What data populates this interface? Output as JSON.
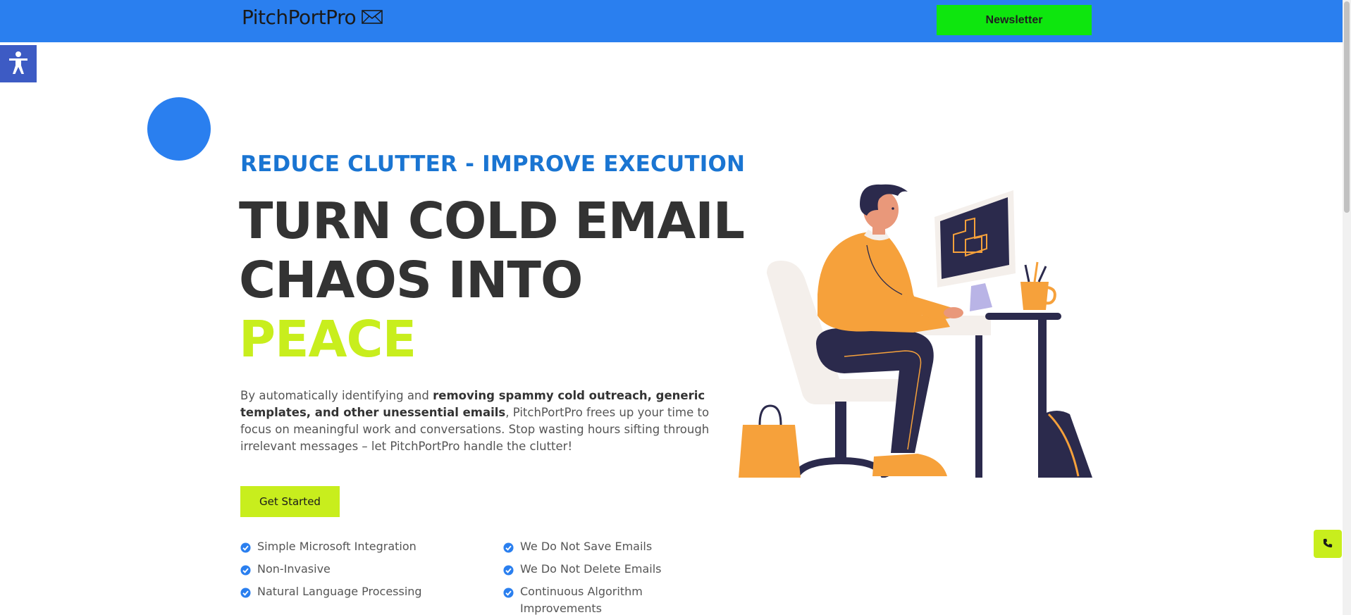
{
  "header": {
    "brand_name": "PitchPortPro",
    "brand_icon": "envelope-icon",
    "newsletter_label": "Newsletter",
    "colors": {
      "bar": "#2a7fef",
      "newsletter": "#0ee60e"
    }
  },
  "accessibility": {
    "icon": "accessibility-person-icon"
  },
  "hero": {
    "eyebrow": "REDUCE CLUTTER - IMPROVE EXECUTION",
    "headline_line1": "TURN COLD EMAIL",
    "headline_line2": "CHAOS INTO",
    "headline_accent": "PEACE",
    "intro_part1": "By automatically identifying and ",
    "intro_bold": "removing spammy cold outreach, generic templates, and other unessential emails",
    "intro_part2": ", PitchPortPro frees up your time to focus on meaningful work and conversations. Stop wasting hours sifting through irrelevant messages – let PitchPortPro handle the clutter!",
    "cta_label": "Get Started",
    "colors": {
      "eyebrow": "#1a75d2",
      "accent": "#c8ee1d",
      "headline": "#333333"
    }
  },
  "features": {
    "col1": [
      "Simple Microsoft Integration",
      "Non-Invasive",
      "Natural Language Processing"
    ],
    "col2": [
      "We Do Not Save Emails",
      "We Do Not Delete Emails",
      "Continuous Algorithm Improvements"
    ],
    "icon": "check-circle-icon"
  },
  "illustration": {
    "icon": "man-at-computer-illustration"
  },
  "floating": {
    "phone_icon": "phone-icon"
  }
}
